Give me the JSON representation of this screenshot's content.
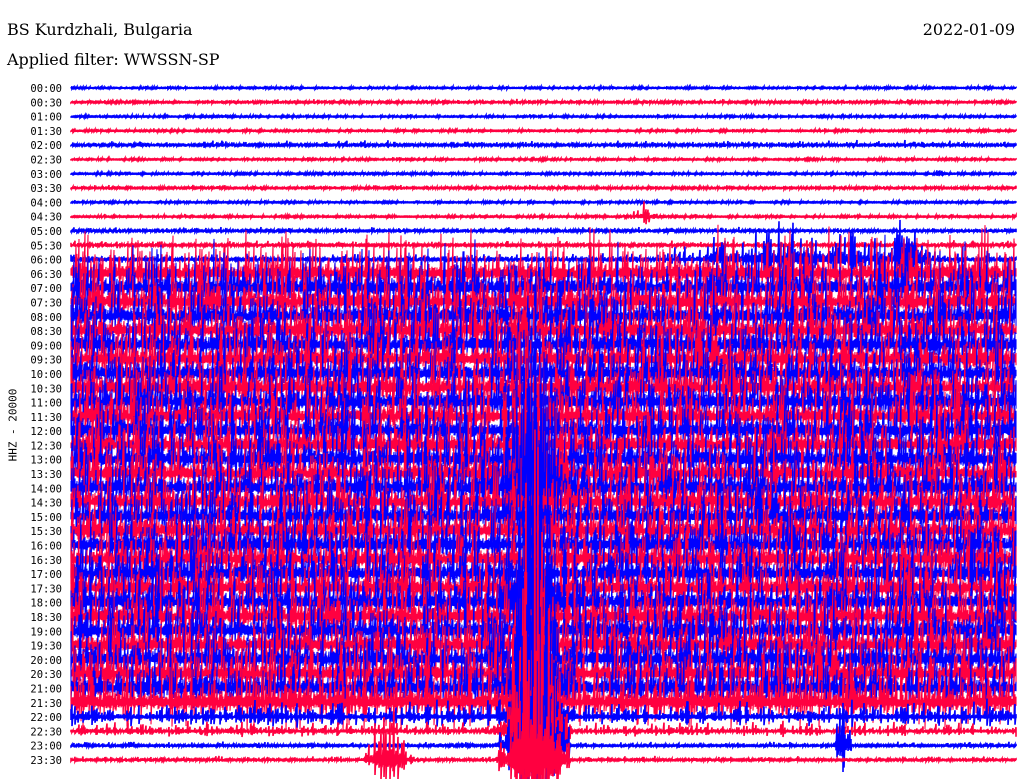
{
  "header": {
    "station": "BS Kurdzhali, Bulgaria",
    "filter": "Applied filter: WWSSN-SP",
    "date": "2022-01-09"
  },
  "chart_data": {
    "type": "line",
    "title": "BS Kurdzhali, Bulgaria",
    "subtitle": "Applied filter: WWSSN-SP",
    "ylabel": "HHZ - 20000",
    "xlabel": "",
    "x_range_minutes": [
      0,
      30
    ],
    "row_labels": [
      "00:00",
      "00:30",
      "01:00",
      "01:30",
      "02:00",
      "02:30",
      "03:00",
      "03:30",
      "04:00",
      "04:30",
      "05:00",
      "05:30",
      "06:00",
      "06:30",
      "07:00",
      "07:30",
      "08:00",
      "08:30",
      "09:00",
      "09:30",
      "10:00",
      "10:30",
      "11:00",
      "11:30",
      "12:00",
      "12:30",
      "13:00",
      "13:30",
      "14:00",
      "14:30",
      "15:00",
      "15:30",
      "16:00",
      "16:30",
      "17:00",
      "17:30",
      "18:00",
      "18:30",
      "19:00",
      "19:30",
      "20:00",
      "20:30",
      "21:00",
      "21:30",
      "22:00",
      "22:30",
      "23:00",
      "23:30"
    ],
    "series_colors": [
      "#0000ff",
      "#ff0040"
    ],
    "noise_level": [
      0.05,
      0.08,
      0.06,
      0.06,
      0.12,
      0.06,
      0.06,
      0.08,
      0.06,
      0.06,
      0.1,
      0.12,
      0.15,
      1.2,
      1.2,
      1.2,
      1.2,
      1.2,
      1.2,
      1.2,
      1.2,
      1.2,
      1.2,
      1.2,
      1.2,
      1.2,
      1.2,
      1.2,
      1.2,
      1.2,
      1.2,
      1.2,
      1.2,
      1.2,
      1.2,
      1.2,
      1.2,
      1.2,
      1.2,
      1.2,
      1.2,
      1.2,
      1.25,
      1.3,
      0.45,
      0.25,
      0.1,
      0.1
    ],
    "events": [
      {
        "row": 6,
        "minute": 27.6,
        "amplitude": 0.6,
        "duration": 0.2
      },
      {
        "row": 9,
        "minute": 18.2,
        "amplitude": 0.35,
        "duration": 1.0
      },
      {
        "row": 12,
        "minute": 23.0,
        "amplitude": 1.0,
        "duration": 7.0
      },
      {
        "row": 12,
        "minute": 26.7,
        "amplitude": 2.5,
        "duration": 0.8
      },
      {
        "row": 27,
        "minute": 14.7,
        "amplitude": 6.0,
        "duration": 1.6
      },
      {
        "row": 28,
        "minute": 14.7,
        "amplitude": 6.0,
        "duration": 1.6
      },
      {
        "row": 36,
        "minute": 14.7,
        "amplitude": 8.0,
        "duration": 1.6
      },
      {
        "row": 42,
        "minute": 14.7,
        "amplitude": 8.0,
        "duration": 1.6
      },
      {
        "row": 44,
        "minute": 14.7,
        "amplitude": 8.0,
        "duration": 1.6
      },
      {
        "row": 45,
        "minute": 14.7,
        "amplitude": 8.0,
        "duration": 1.6
      },
      {
        "row": 46,
        "minute": 14.7,
        "amplitude": 8.0,
        "duration": 1.6
      },
      {
        "row": 47,
        "minute": 14.7,
        "amplitude": 8.0,
        "duration": 1.6
      },
      {
        "row": 46,
        "minute": 24.5,
        "amplitude": 2.0,
        "duration": 0.5
      },
      {
        "row": 47,
        "minute": 10.0,
        "amplitude": 2.2,
        "duration": 1.2
      }
    ]
  }
}
